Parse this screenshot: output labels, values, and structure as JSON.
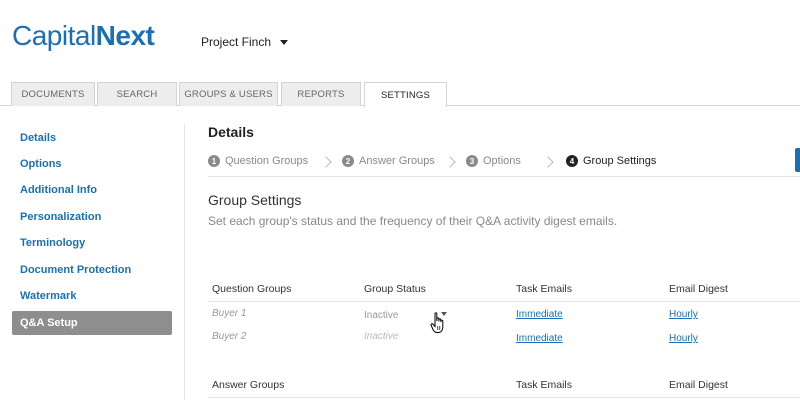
{
  "header": {
    "logo_part1": "Capital",
    "logo_part2": "Next",
    "project_label": "Project Finch"
  },
  "tabs": [
    {
      "label": "DOCUMENTS"
    },
    {
      "label": "SEARCH"
    },
    {
      "label": "GROUPS & USERS"
    },
    {
      "label": "REPORTS"
    },
    {
      "label": "SETTINGS",
      "active": true
    }
  ],
  "sidebar": {
    "items": [
      {
        "label": "Details"
      },
      {
        "label": "Options"
      },
      {
        "label": "Additional Info"
      },
      {
        "label": "Personalization"
      },
      {
        "label": "Terminology"
      },
      {
        "label": "Document Protection"
      },
      {
        "label": "Watermark"
      },
      {
        "label": "Q&A Setup",
        "active": true
      }
    ]
  },
  "main": {
    "title": "Details",
    "steps": [
      {
        "num": "1",
        "label": "Question Groups"
      },
      {
        "num": "2",
        "label": "Answer Groups"
      },
      {
        "num": "3",
        "label": "Options"
      },
      {
        "num": "4",
        "label": "Group Settings",
        "active": true
      }
    ],
    "section_title": "Group Settings",
    "section_desc": "Set each group's status and the frequency of their Q&A activity digest emails."
  },
  "question_table": {
    "headers": [
      "Question Groups",
      "Group Status",
      "Task Emails",
      "Email Digest"
    ],
    "rows": [
      {
        "name": "Buyer 1",
        "status": "Inactive",
        "task": "Immediate",
        "digest": "Hourly"
      },
      {
        "name": "Buyer 2",
        "status": "Inactive",
        "task": "Immediate",
        "digest": "Hourly"
      }
    ]
  },
  "answer_table": {
    "headers": [
      "Answer Groups",
      "Task Emails",
      "Email Digest"
    ]
  },
  "colors": {
    "accent": "#1a6fb5",
    "sidebar_active": "#8e8e8e"
  }
}
